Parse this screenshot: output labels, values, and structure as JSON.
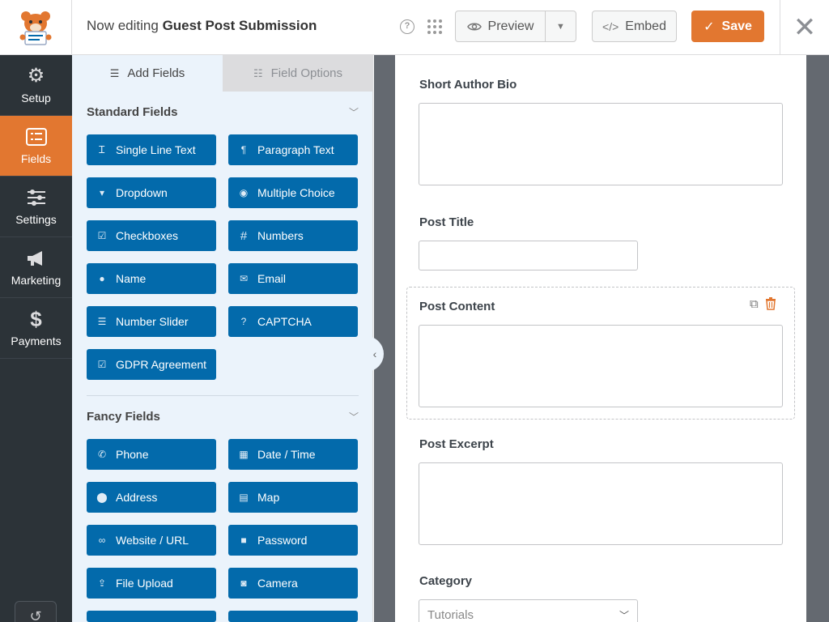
{
  "header": {
    "title_prefix": "Now editing",
    "form_name": "Guest Post Submission",
    "preview_label": "Preview",
    "embed_label": "Embed",
    "save_label": "Save"
  },
  "nav": [
    {
      "label": "Setup",
      "icon": "gear-icon"
    },
    {
      "label": "Fields",
      "icon": "list-icon",
      "active": true
    },
    {
      "label": "Settings",
      "icon": "sliders-icon"
    },
    {
      "label": "Marketing",
      "icon": "megaphone-icon"
    },
    {
      "label": "Payments",
      "icon": "dollar-icon"
    }
  ],
  "panel": {
    "tab_add": "Add Fields",
    "tab_options": "Field Options",
    "standard_title": "Standard Fields",
    "fancy_title": "Fancy Fields",
    "standard_fields": [
      "Single Line Text",
      "Paragraph Text",
      "Dropdown",
      "Multiple Choice",
      "Checkboxes",
      "Numbers",
      "Name",
      "Email",
      "Number Slider",
      "CAPTCHA",
      "GDPR Agreement"
    ],
    "fancy_fields": [
      "Phone",
      "Date / Time",
      "Address",
      "Map",
      "Website / URL",
      "Password",
      "File Upload",
      "Camera"
    ]
  },
  "form": {
    "short_bio_label": "Short Author Bio",
    "post_title_label": "Post Title",
    "post_content_label": "Post Content",
    "post_excerpt_label": "Post Excerpt",
    "category_label": "Category",
    "category_value": "Tutorials"
  },
  "colors": {
    "accent": "#e27730",
    "field_button": "#036aab",
    "nav_bg": "#2c3338"
  }
}
